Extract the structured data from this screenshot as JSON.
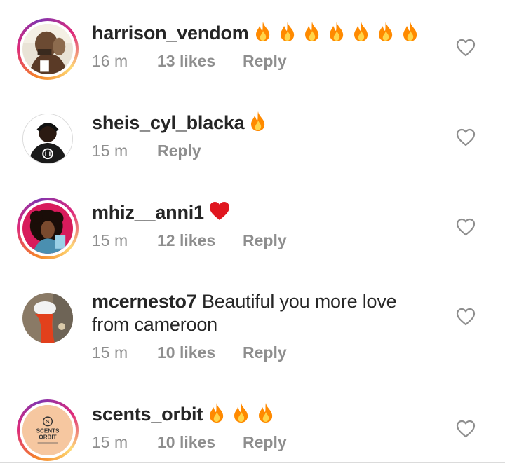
{
  "comments": [
    {
      "username": "harrison_vendom",
      "text": "",
      "emojis": [
        "fire",
        "fire",
        "fire",
        "fire",
        "fire",
        "fire",
        "fire"
      ],
      "time": "16 m",
      "likes": "13 likes",
      "reply": "Reply",
      "story_ring": true
    },
    {
      "username": "sheis_cyl_blacka",
      "text": "",
      "emojis": [
        "fire"
      ],
      "time": "15 m",
      "likes": "",
      "reply": "Reply",
      "story_ring": false
    },
    {
      "username": "mhiz__anni1",
      "text": "",
      "emojis": [
        "red-heart"
      ],
      "time": "15 m",
      "likes": "12 likes",
      "reply": "Reply",
      "story_ring": true
    },
    {
      "username": "mcernesto7",
      "text": "Beautiful  you more love from cameroon",
      "emojis": [],
      "time": "15 m",
      "likes": "10 likes",
      "reply": "Reply",
      "story_ring": false
    },
    {
      "username": "scents_orbit",
      "text": "",
      "emojis": [
        "fire",
        "fire",
        "fire"
      ],
      "time": "15 m",
      "likes": "10 likes",
      "reply": "Reply",
      "story_ring": true,
      "avatar_logo_text": [
        "SCENTS",
        "ORBIT"
      ]
    }
  ],
  "colors": {
    "meta_gray": "#8e8e8e",
    "username": "#262626",
    "heart_red": "#ed1c24",
    "ring_orange": "#f58529",
    "ring_pink": "#dd2a7b"
  }
}
